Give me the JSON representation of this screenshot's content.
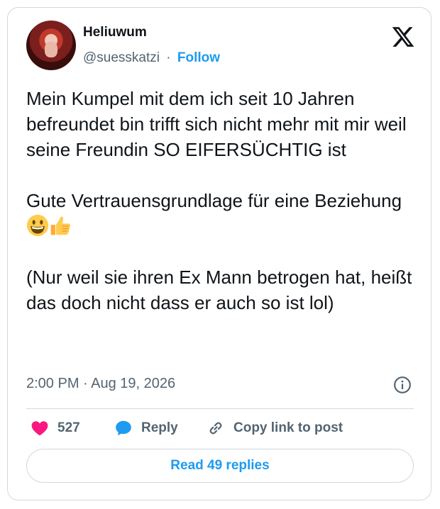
{
  "user": {
    "name": "Heliuwum",
    "handle": "@suesskatzi",
    "separator": "·",
    "follow_label": "Follow"
  },
  "tweet": {
    "paragraph1": "Mein Kumpel mit dem ich seit 10 Jahren befreundet bin trifft sich nicht mehr mit mir weil seine Freundin SO EIFERSÜCHTIG ist",
    "paragraph2_text": "Gute Vertrauensgrundlage für eine Beziehung",
    "paragraph2_emojis": [
      "grinning-face-emoji",
      "thumbs-up-emoji"
    ],
    "paragraph3": "(Nur weil sie ihren Ex Mann betrogen hat, heißt das doch nicht dass er auch so ist lol)",
    "timestamp": "2:00 PM · Aug 19, 2026"
  },
  "actions": {
    "like_count": "527",
    "reply_label": "Reply",
    "copy_label": "Copy link to post"
  },
  "read_replies_label": "Read 49 replies",
  "icons": {
    "logo": "x-logo-icon",
    "info": "info-icon",
    "like": "heart-icon",
    "reply": "speech-bubble-icon",
    "copy": "link-icon"
  },
  "colors": {
    "accent": "#1d9bf0",
    "like": "#f91880",
    "text": "#0f1419",
    "muted": "#536471",
    "border": "#cfd9de"
  }
}
